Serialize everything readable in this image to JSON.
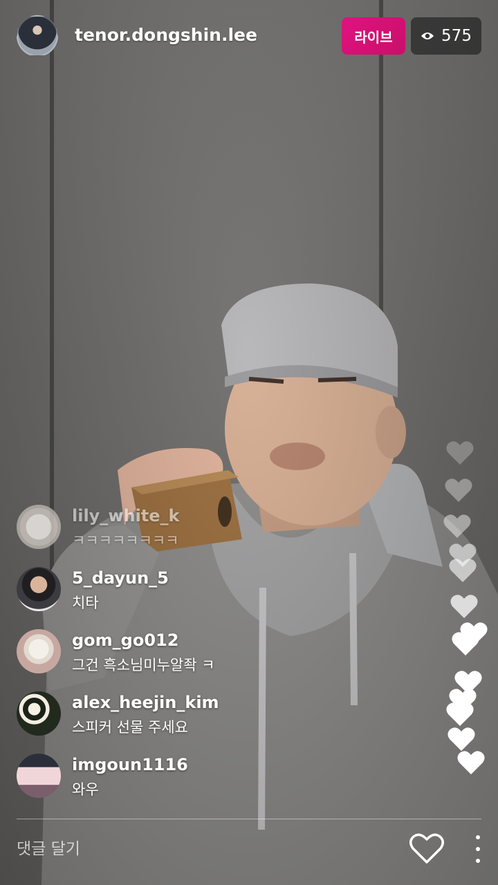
{
  "header": {
    "host_name": "tenor.dongshin.lee",
    "live_label": "라이브",
    "viewer_count": "575",
    "viewer_icon": "eye-icon"
  },
  "comments": [
    {
      "user": "lily_white_k",
      "text": "ㅋㅋㅋㅋㅋㅋㅋㅋ",
      "avatar": "cat-avatar"
    },
    {
      "user": "5_dayun_5",
      "text": "치타",
      "avatar": "man-avatar"
    },
    {
      "user": "gom_go012",
      "text": "그건 흑소님미누알좍 ㅋ",
      "avatar": "teddy-bear-avatar"
    },
    {
      "user": "alex_heejin_kim",
      "text": "스피커 선물 주세요",
      "avatar": "flower-avatar"
    },
    {
      "user": "imgoun1116",
      "text": "와우",
      "avatar": "cake-avatar"
    }
  ],
  "footer": {
    "comment_placeholder": "댓글 달기",
    "like_icon": "heart-icon",
    "more_icon": "more-vertical-icon"
  },
  "colors": {
    "live_badge": "#d81178",
    "viewer_badge_bg": "#2e2e2e",
    "text": "#ffffff"
  }
}
